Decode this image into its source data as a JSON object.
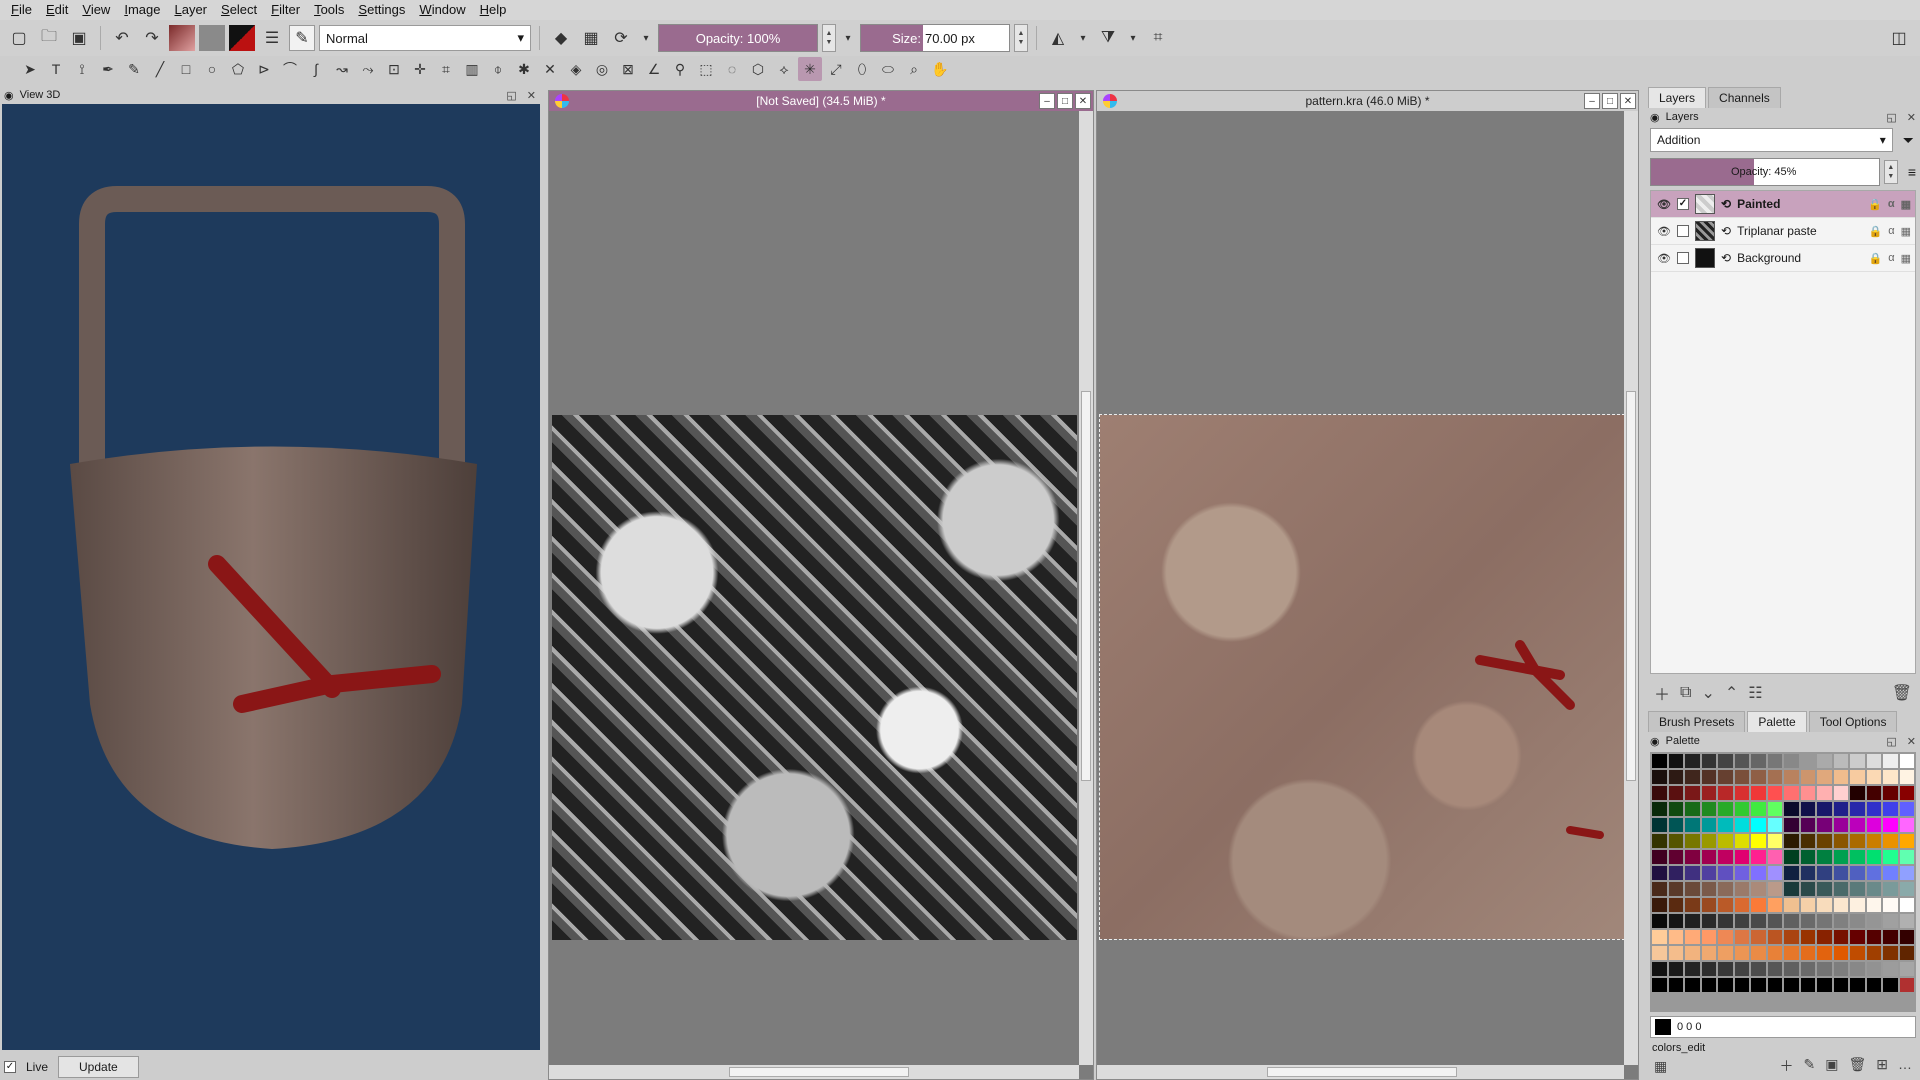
{
  "menu": [
    "File",
    "Edit",
    "View",
    "Image",
    "Layer",
    "Select",
    "Filter",
    "Tools",
    "Settings",
    "Window",
    "Help"
  ],
  "toolbar": {
    "blend_mode": "Normal",
    "opacity_label": "Opacity: 100%",
    "size_label": "Size:",
    "size_value": "70.00 px"
  },
  "view3d": {
    "title": "View 3D",
    "live_label": "Live",
    "live_checked": true,
    "update_button": "Update"
  },
  "doc1": {
    "title": "[Not Saved]  (34.5 MiB) *"
  },
  "doc2": {
    "title": "pattern.kra (46.0 MiB) *"
  },
  "dock": {
    "tabs_top": [
      "Layers",
      "Channels"
    ],
    "layers_title": "Layers",
    "blend_mode": "Addition",
    "opacity_label": "Opacity:  45%",
    "opacity_value": 45,
    "layers": [
      {
        "name": "Painted",
        "selected": true
      },
      {
        "name": "Triplanar paste",
        "selected": false
      },
      {
        "name": "Background",
        "selected": false
      }
    ],
    "tabs_bottom": [
      "Brush Presets",
      "Palette",
      "Tool Options"
    ],
    "palette_title": "Palette",
    "fg_color_value": "0 0 0",
    "palette_name": "colors_edit"
  },
  "colors": {
    "accent": "#9a6b8f",
    "viewport_bg": "#1e3a5c",
    "stroke_red": "#8a1616"
  }
}
